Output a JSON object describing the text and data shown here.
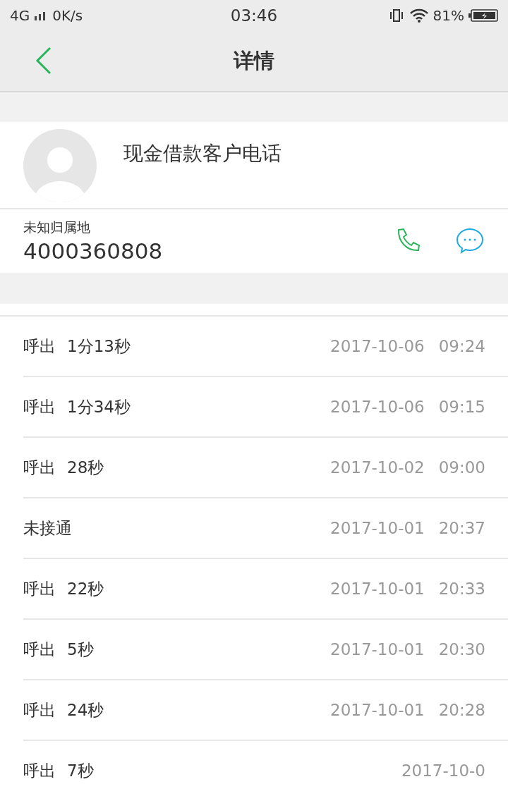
{
  "status_bar": {
    "network": "4G",
    "speed": "0K/s",
    "time": "03:46",
    "battery": "81%"
  },
  "header": {
    "title": "详情"
  },
  "contact": {
    "name": "现金借款客户电话",
    "location": "未知归属地",
    "number": "4000360808"
  },
  "calls": [
    {
      "type": "呼出",
      "duration": "1分13秒",
      "date": "2017-10-06",
      "time": "09:24"
    },
    {
      "type": "呼出",
      "duration": "1分34秒",
      "date": "2017-10-06",
      "time": "09:15"
    },
    {
      "type": "呼出",
      "duration": "28秒",
      "date": "2017-10-02",
      "time": "09:00"
    },
    {
      "type": "未接通",
      "date": "2017-10-01",
      "time": "20:37"
    },
    {
      "type": "呼出",
      "duration": "22秒",
      "date": "2017-10-01",
      "time": "20:33"
    },
    {
      "type": "呼出",
      "duration": "5秒",
      "date": "2017-10-01",
      "time": "20:30"
    },
    {
      "type": "呼出",
      "duration": "24秒",
      "date": "2017-10-01",
      "time": "20:28"
    },
    {
      "type": "呼出",
      "duration": "7秒",
      "date": "2017-10-0"
    }
  ]
}
